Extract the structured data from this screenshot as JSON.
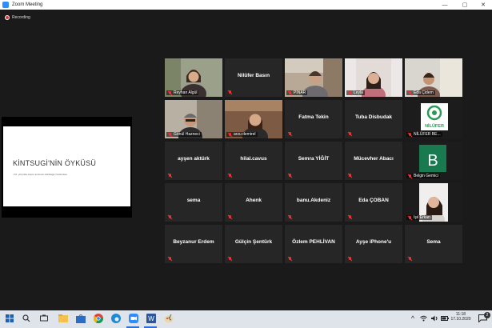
{
  "window": {
    "title": "Zoom Meeting",
    "controls": [
      "—",
      "▢",
      "✕"
    ]
  },
  "recording": {
    "label": "Recording"
  },
  "shared_slide": {
    "title": "KİNTSUGİ'NİN ÖYKÜSÜ",
    "bullet": "• 15. yüzyılda Japon kırılmam Ashikaga Yoshimasa"
  },
  "participants": [
    {
      "name": "Reyhan Algül",
      "video": true,
      "active": true
    },
    {
      "name": "Nilüfer Basın",
      "video": false
    },
    {
      "name": "PINAR",
      "video": true
    },
    {
      "name": "Leyla",
      "video": true
    },
    {
      "name": "Eda Çidem",
      "video": true
    },
    {
      "name": "Gönül Hazneci",
      "video": true
    },
    {
      "name": "arzu demirel",
      "video": true
    },
    {
      "name": "Fatma Tekin",
      "video": false
    },
    {
      "name": "Tuba Disbudak",
      "video": false
    },
    {
      "name": "NİLÜFER BE...",
      "video": true,
      "logo_text": "NİLÜFER"
    },
    {
      "name": "ayşen aktürk",
      "video": false
    },
    {
      "name": "hilal.cavus",
      "video": false
    },
    {
      "name": "Semra YİĞİT",
      "video": false
    },
    {
      "name": "Mücevher Abacı",
      "video": false
    },
    {
      "name": "Belgin Gemici",
      "video": true,
      "avatar_letter": "B"
    },
    {
      "name": "sema",
      "video": false
    },
    {
      "name": "Ahenk",
      "video": false
    },
    {
      "name": "banu.Akdeniz",
      "video": false
    },
    {
      "name": "Eda ÇOBAN",
      "video": false
    },
    {
      "name": "Işıl Erkan",
      "video": true
    },
    {
      "name": "Beyzanur Erdem",
      "video": false
    },
    {
      "name": "Gülçin Şentürk",
      "video": false
    },
    {
      "name": "Özlem PEHLİVAN",
      "video": false
    },
    {
      "name": "Ayşe iPhone'u",
      "video": false
    },
    {
      "name": "Sema",
      "video": false
    }
  ],
  "taskbar": {
    "time": "11:18",
    "date": "17.10.2020",
    "notification_count": "2",
    "apps": [
      "windows-start-icon",
      "search-icon",
      "task-view-icon",
      "file-explorer-icon",
      "store-icon",
      "mail-icon",
      "chrome-icon",
      "edge-icon",
      "zoom-icon",
      "word-icon",
      "paint-icon"
    ]
  }
}
